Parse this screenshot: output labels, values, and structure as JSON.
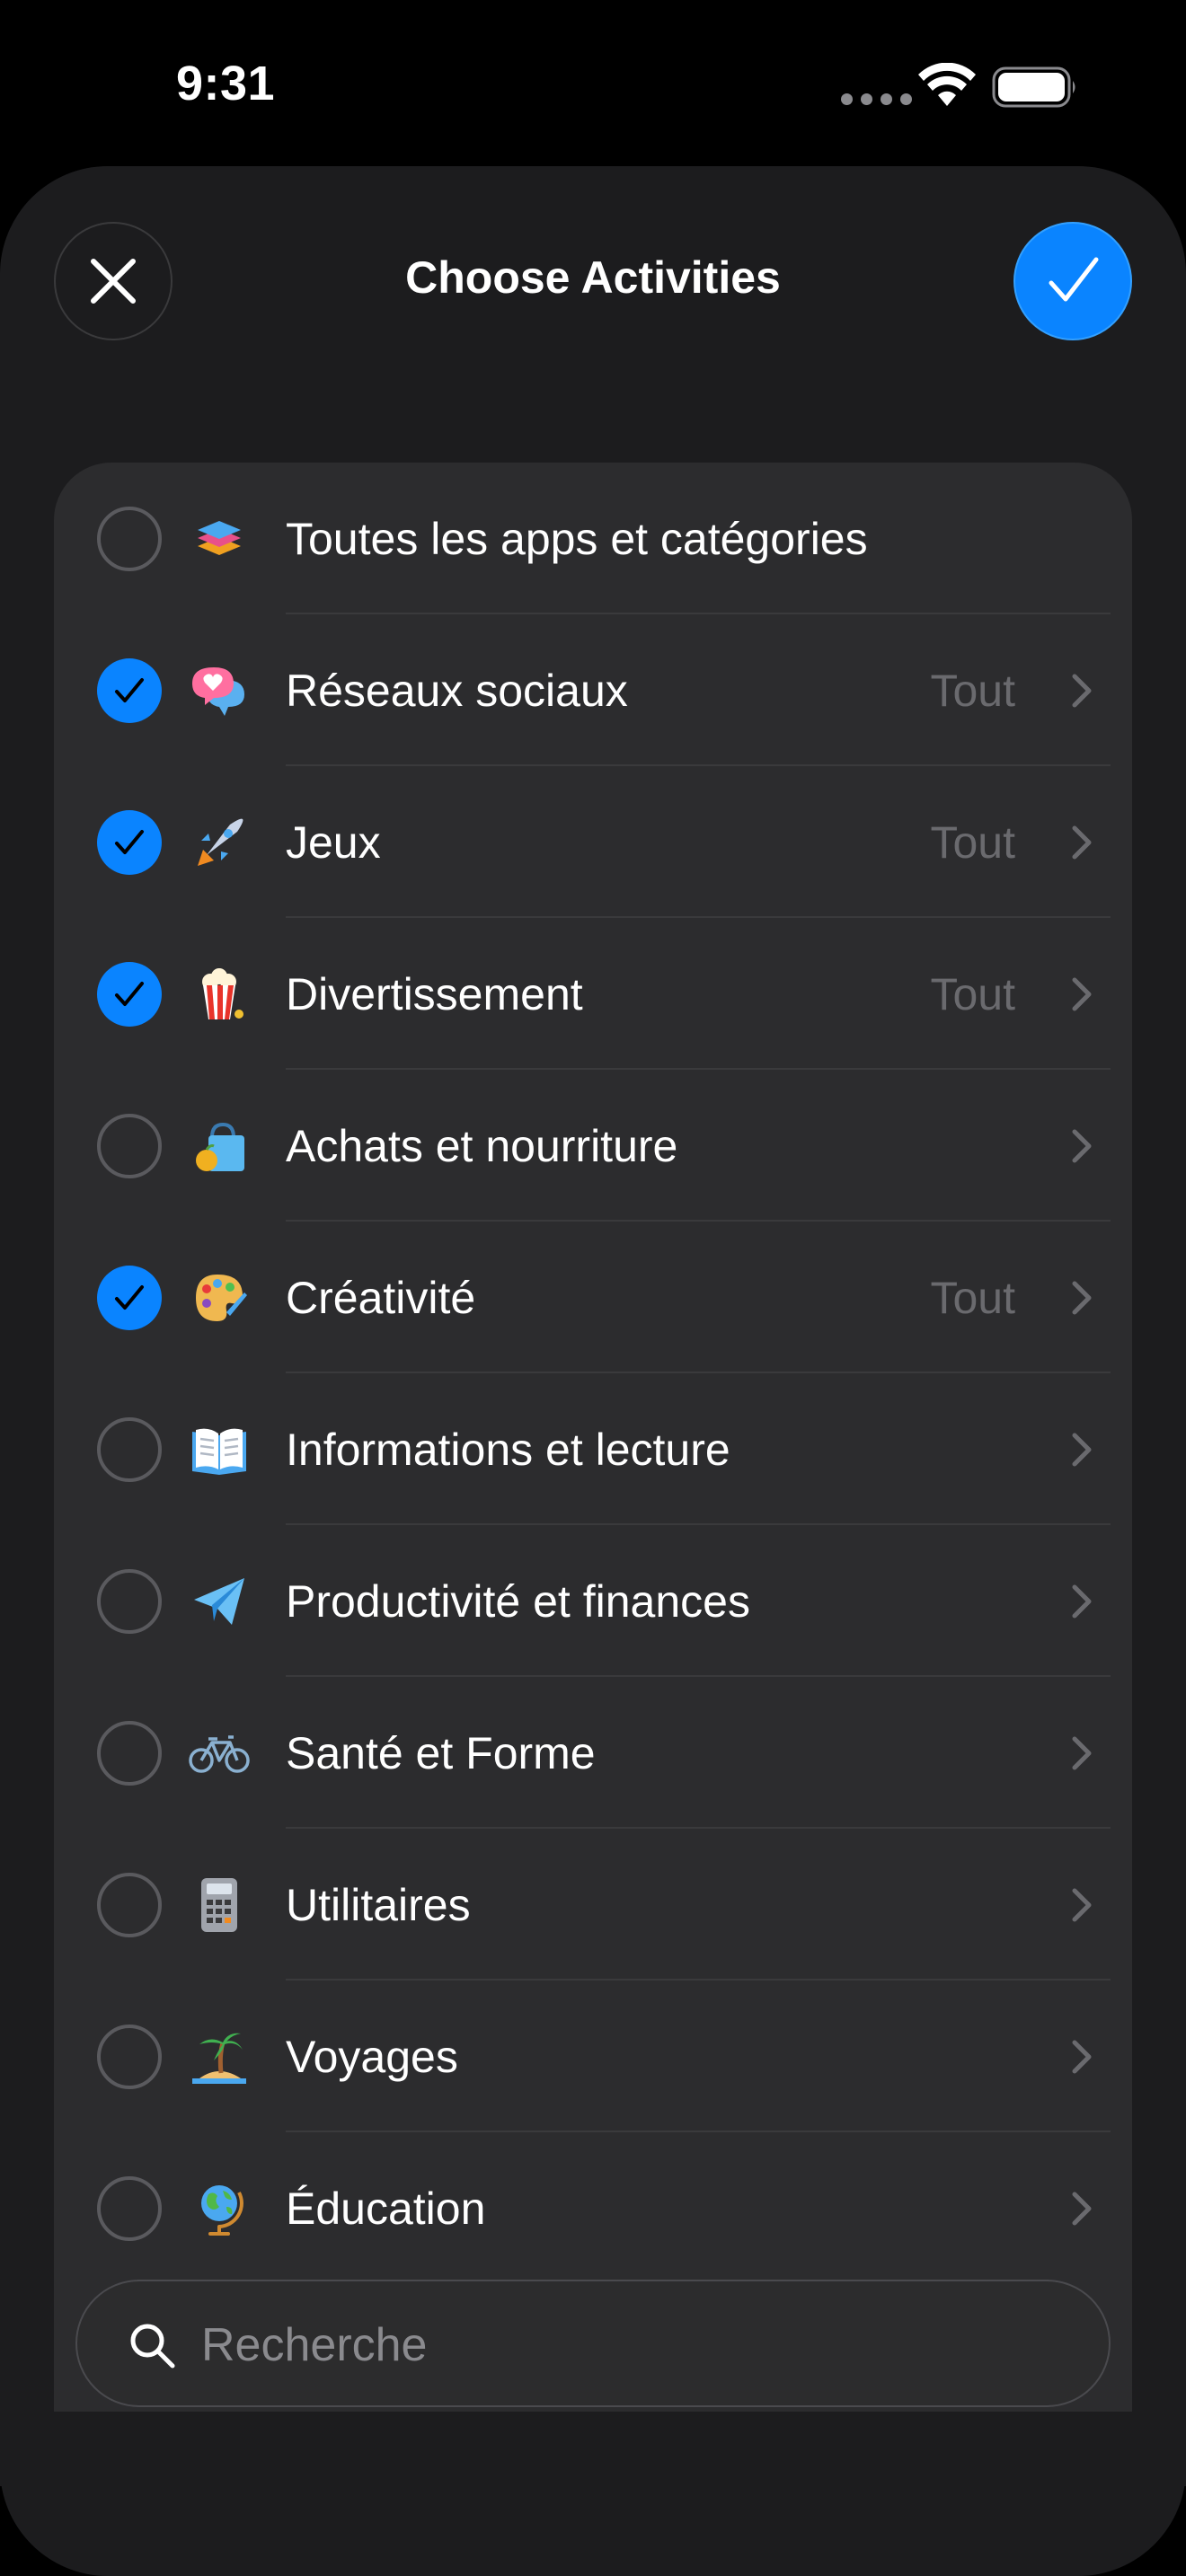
{
  "status_bar": {
    "time": "9:31"
  },
  "sheet": {
    "title": "Choose Activities",
    "accent_color": "#0a84ff"
  },
  "list": {
    "items": [
      {
        "label": "Toutes les apps et catégories",
        "checked": false,
        "value": "",
        "chevron": false,
        "icon": "stack-layers-icon"
      },
      {
        "label": "Réseaux sociaux",
        "checked": true,
        "value": "Tout",
        "chevron": true,
        "icon": "heart-speech-bubble-icon"
      },
      {
        "label": "Jeux",
        "checked": true,
        "value": "Tout",
        "chevron": true,
        "icon": "rocket-icon"
      },
      {
        "label": "Divertissement",
        "checked": true,
        "value": "Tout",
        "chevron": true,
        "icon": "popcorn-icon"
      },
      {
        "label": "Achats et nourriture",
        "checked": false,
        "value": "",
        "chevron": true,
        "icon": "shopping-bag-icon"
      },
      {
        "label": "Créativité",
        "checked": true,
        "value": "Tout",
        "chevron": true,
        "icon": "palette-icon"
      },
      {
        "label": "Informations et lecture",
        "checked": false,
        "value": "",
        "chevron": true,
        "icon": "open-book-icon"
      },
      {
        "label": "Productivité et finances",
        "checked": false,
        "value": "",
        "chevron": true,
        "icon": "paper-plane-icon"
      },
      {
        "label": "Santé et Forme",
        "checked": false,
        "value": "",
        "chevron": true,
        "icon": "bicycle-icon"
      },
      {
        "label": "Utilitaires",
        "checked": false,
        "value": "",
        "chevron": true,
        "icon": "calculator-icon"
      },
      {
        "label": "Voyages",
        "checked": false,
        "value": "",
        "chevron": true,
        "icon": "palm-island-icon"
      },
      {
        "label": "Éducation",
        "checked": false,
        "value": "",
        "chevron": true,
        "icon": "globe-icon"
      }
    ]
  },
  "search": {
    "placeholder": "Recherche",
    "value": ""
  }
}
